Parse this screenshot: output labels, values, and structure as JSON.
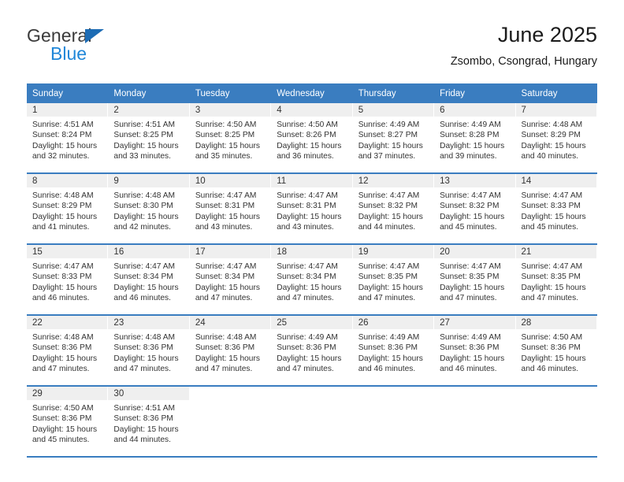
{
  "brand": {
    "name_top": "General",
    "name_bottom": "Blue",
    "triangle_color": "#1d6cb5",
    "blue_color": "#1f86d8"
  },
  "header": {
    "title": "June 2025",
    "subtitle": "Zsombo, Csongrad, Hungary"
  },
  "theme": {
    "header_blue": "#3a7dc0",
    "daynum_background": "#efefef",
    "text": "#333333"
  },
  "calendar": {
    "weekday_headers": [
      "Sunday",
      "Monday",
      "Tuesday",
      "Wednesday",
      "Thursday",
      "Friday",
      "Saturday"
    ],
    "weeks": [
      [
        {
          "day": "1",
          "sunrise": "Sunrise: 4:51 AM",
          "sunset": "Sunset: 8:24 PM",
          "daylight_line1": "Daylight: 15 hours",
          "daylight_line2": "and 32 minutes."
        },
        {
          "day": "2",
          "sunrise": "Sunrise: 4:51 AM",
          "sunset": "Sunset: 8:25 PM",
          "daylight_line1": "Daylight: 15 hours",
          "daylight_line2": "and 33 minutes."
        },
        {
          "day": "3",
          "sunrise": "Sunrise: 4:50 AM",
          "sunset": "Sunset: 8:25 PM",
          "daylight_line1": "Daylight: 15 hours",
          "daylight_line2": "and 35 minutes."
        },
        {
          "day": "4",
          "sunrise": "Sunrise: 4:50 AM",
          "sunset": "Sunset: 8:26 PM",
          "daylight_line1": "Daylight: 15 hours",
          "daylight_line2": "and 36 minutes."
        },
        {
          "day": "5",
          "sunrise": "Sunrise: 4:49 AM",
          "sunset": "Sunset: 8:27 PM",
          "daylight_line1": "Daylight: 15 hours",
          "daylight_line2": "and 37 minutes."
        },
        {
          "day": "6",
          "sunrise": "Sunrise: 4:49 AM",
          "sunset": "Sunset: 8:28 PM",
          "daylight_line1": "Daylight: 15 hours",
          "daylight_line2": "and 39 minutes."
        },
        {
          "day": "7",
          "sunrise": "Sunrise: 4:48 AM",
          "sunset": "Sunset: 8:29 PM",
          "daylight_line1": "Daylight: 15 hours",
          "daylight_line2": "and 40 minutes."
        }
      ],
      [
        {
          "day": "8",
          "sunrise": "Sunrise: 4:48 AM",
          "sunset": "Sunset: 8:29 PM",
          "daylight_line1": "Daylight: 15 hours",
          "daylight_line2": "and 41 minutes."
        },
        {
          "day": "9",
          "sunrise": "Sunrise: 4:48 AM",
          "sunset": "Sunset: 8:30 PM",
          "daylight_line1": "Daylight: 15 hours",
          "daylight_line2": "and 42 minutes."
        },
        {
          "day": "10",
          "sunrise": "Sunrise: 4:47 AM",
          "sunset": "Sunset: 8:31 PM",
          "daylight_line1": "Daylight: 15 hours",
          "daylight_line2": "and 43 minutes."
        },
        {
          "day": "11",
          "sunrise": "Sunrise: 4:47 AM",
          "sunset": "Sunset: 8:31 PM",
          "daylight_line1": "Daylight: 15 hours",
          "daylight_line2": "and 43 minutes."
        },
        {
          "day": "12",
          "sunrise": "Sunrise: 4:47 AM",
          "sunset": "Sunset: 8:32 PM",
          "daylight_line1": "Daylight: 15 hours",
          "daylight_line2": "and 44 minutes."
        },
        {
          "day": "13",
          "sunrise": "Sunrise: 4:47 AM",
          "sunset": "Sunset: 8:32 PM",
          "daylight_line1": "Daylight: 15 hours",
          "daylight_line2": "and 45 minutes."
        },
        {
          "day": "14",
          "sunrise": "Sunrise: 4:47 AM",
          "sunset": "Sunset: 8:33 PM",
          "daylight_line1": "Daylight: 15 hours",
          "daylight_line2": "and 45 minutes."
        }
      ],
      [
        {
          "day": "15",
          "sunrise": "Sunrise: 4:47 AM",
          "sunset": "Sunset: 8:33 PM",
          "daylight_line1": "Daylight: 15 hours",
          "daylight_line2": "and 46 minutes."
        },
        {
          "day": "16",
          "sunrise": "Sunrise: 4:47 AM",
          "sunset": "Sunset: 8:34 PM",
          "daylight_line1": "Daylight: 15 hours",
          "daylight_line2": "and 46 minutes."
        },
        {
          "day": "17",
          "sunrise": "Sunrise: 4:47 AM",
          "sunset": "Sunset: 8:34 PM",
          "daylight_line1": "Daylight: 15 hours",
          "daylight_line2": "and 47 minutes."
        },
        {
          "day": "18",
          "sunrise": "Sunrise: 4:47 AM",
          "sunset": "Sunset: 8:34 PM",
          "daylight_line1": "Daylight: 15 hours",
          "daylight_line2": "and 47 minutes."
        },
        {
          "day": "19",
          "sunrise": "Sunrise: 4:47 AM",
          "sunset": "Sunset: 8:35 PM",
          "daylight_line1": "Daylight: 15 hours",
          "daylight_line2": "and 47 minutes."
        },
        {
          "day": "20",
          "sunrise": "Sunrise: 4:47 AM",
          "sunset": "Sunset: 8:35 PM",
          "daylight_line1": "Daylight: 15 hours",
          "daylight_line2": "and 47 minutes."
        },
        {
          "day": "21",
          "sunrise": "Sunrise: 4:47 AM",
          "sunset": "Sunset: 8:35 PM",
          "daylight_line1": "Daylight: 15 hours",
          "daylight_line2": "and 47 minutes."
        }
      ],
      [
        {
          "day": "22",
          "sunrise": "Sunrise: 4:48 AM",
          "sunset": "Sunset: 8:36 PM",
          "daylight_line1": "Daylight: 15 hours",
          "daylight_line2": "and 47 minutes."
        },
        {
          "day": "23",
          "sunrise": "Sunrise: 4:48 AM",
          "sunset": "Sunset: 8:36 PM",
          "daylight_line1": "Daylight: 15 hours",
          "daylight_line2": "and 47 minutes."
        },
        {
          "day": "24",
          "sunrise": "Sunrise: 4:48 AM",
          "sunset": "Sunset: 8:36 PM",
          "daylight_line1": "Daylight: 15 hours",
          "daylight_line2": "and 47 minutes."
        },
        {
          "day": "25",
          "sunrise": "Sunrise: 4:49 AM",
          "sunset": "Sunset: 8:36 PM",
          "daylight_line1": "Daylight: 15 hours",
          "daylight_line2": "and 47 minutes."
        },
        {
          "day": "26",
          "sunrise": "Sunrise: 4:49 AM",
          "sunset": "Sunset: 8:36 PM",
          "daylight_line1": "Daylight: 15 hours",
          "daylight_line2": "and 46 minutes."
        },
        {
          "day": "27",
          "sunrise": "Sunrise: 4:49 AM",
          "sunset": "Sunset: 8:36 PM",
          "daylight_line1": "Daylight: 15 hours",
          "daylight_line2": "and 46 minutes."
        },
        {
          "day": "28",
          "sunrise": "Sunrise: 4:50 AM",
          "sunset": "Sunset: 8:36 PM",
          "daylight_line1": "Daylight: 15 hours",
          "daylight_line2": "and 46 minutes."
        }
      ],
      [
        {
          "day": "29",
          "sunrise": "Sunrise: 4:50 AM",
          "sunset": "Sunset: 8:36 PM",
          "daylight_line1": "Daylight: 15 hours",
          "daylight_line2": "and 45 minutes."
        },
        {
          "day": "30",
          "sunrise": "Sunrise: 4:51 AM",
          "sunset": "Sunset: 8:36 PM",
          "daylight_line1": "Daylight: 15 hours",
          "daylight_line2": "and 44 minutes."
        },
        {
          "day": "",
          "sunrise": "",
          "sunset": "",
          "daylight_line1": "",
          "daylight_line2": ""
        },
        {
          "day": "",
          "sunrise": "",
          "sunset": "",
          "daylight_line1": "",
          "daylight_line2": ""
        },
        {
          "day": "",
          "sunrise": "",
          "sunset": "",
          "daylight_line1": "",
          "daylight_line2": ""
        },
        {
          "day": "",
          "sunrise": "",
          "sunset": "",
          "daylight_line1": "",
          "daylight_line2": ""
        },
        {
          "day": "",
          "sunrise": "",
          "sunset": "",
          "daylight_line1": "",
          "daylight_line2": ""
        }
      ]
    ]
  }
}
